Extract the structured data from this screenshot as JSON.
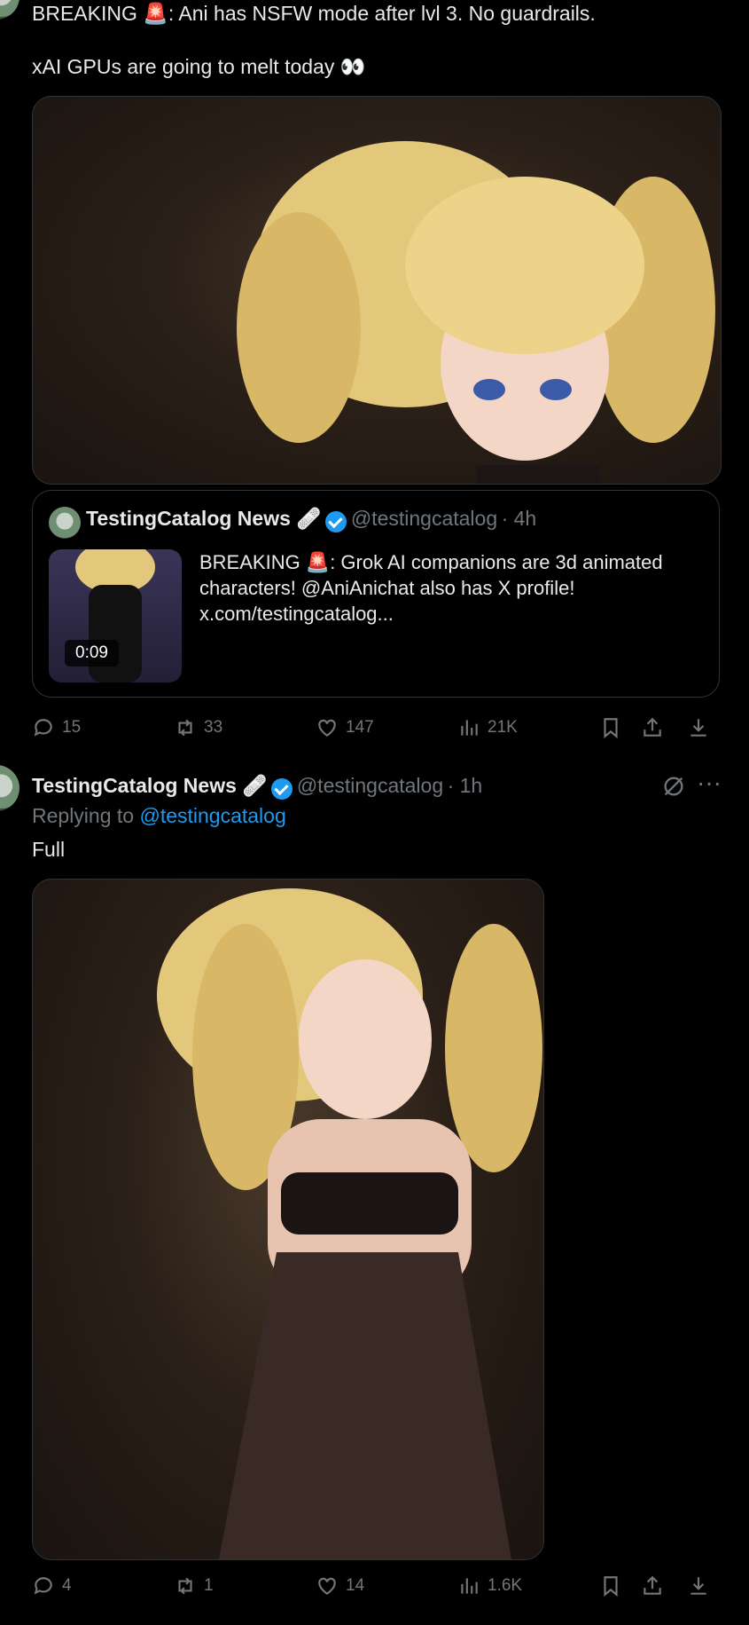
{
  "post1": {
    "text_line1": "BREAKING 🚨: Ani has NSFW mode after lvl 3. No guardrails.",
    "text_line2": "xAI GPUs are going to melt today 👀",
    "media_label": "Anime character with blonde twin-tails portrait",
    "quote": {
      "name": "TestingCatalog News 🩹",
      "handle": "@testingcatalog",
      "time": "· 4h",
      "text": "BREAKING 🚨: Grok AI companions are 3d animated characters! @AniAnichat also has X profile! x.com/testingcatalog...",
      "video_duration": "0:09"
    },
    "actions": {
      "replies": "15",
      "reposts": "33",
      "likes": "147",
      "views": "21K"
    }
  },
  "post2": {
    "name": "TestingCatalog News 🩹",
    "handle": "@testingcatalog",
    "time": "· 1h",
    "replying_prefix": "Replying to",
    "replying_to": "@testingcatalog",
    "text": "Full",
    "media_label": "Full body anime character render",
    "actions": {
      "replies": "4",
      "reposts": "1",
      "likes": "14",
      "views": "1.6K"
    }
  },
  "icons": {
    "reply": "reply-icon",
    "repost": "repost-icon",
    "like": "heart-icon",
    "views": "views-icon",
    "bookmark": "bookmark-icon",
    "share": "share-icon",
    "download": "download-icon",
    "more": "more-icon",
    "grok": "grok-icon"
  },
  "colors": {
    "accent": "#1d9bf0",
    "muted": "#71767b",
    "background": "#000000"
  }
}
